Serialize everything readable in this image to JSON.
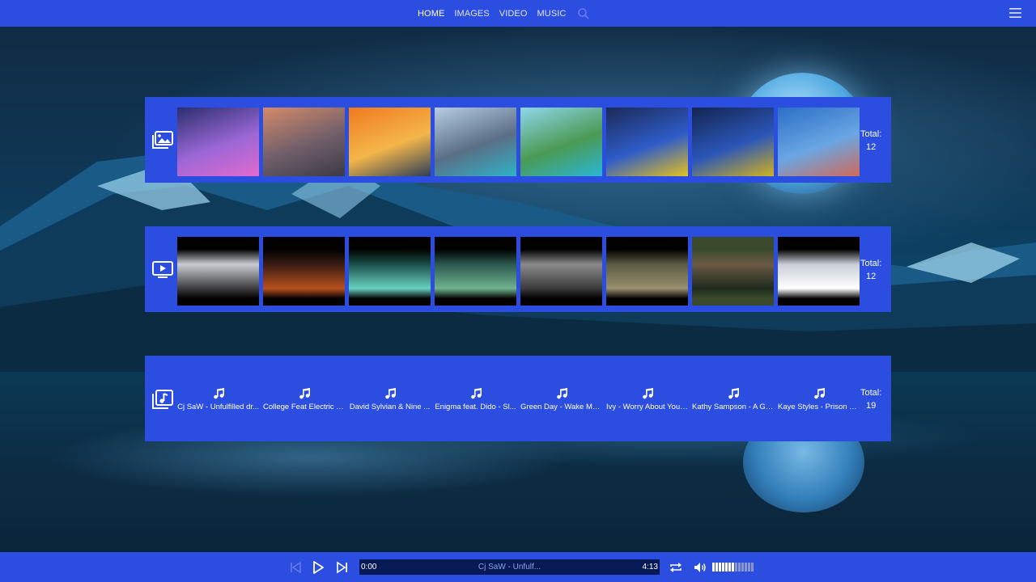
{
  "nav": {
    "items": [
      "HOME",
      "IMAGES",
      "VIDEO",
      "MUSIC"
    ],
    "active": "HOME",
    "icons": [
      "search-icon",
      "menu-icon"
    ]
  },
  "images_panel": {
    "icon": "images-icon",
    "total_label": "Total:",
    "total_value": "12",
    "thumbnails": [
      {
        "name": "cyberpunk-girl",
        "colors": [
          "#2a2f6e",
          "#9b67d6",
          "#e26ad0"
        ]
      },
      {
        "name": "misty-mountains",
        "colors": [
          "#d48a6a",
          "#6f5e6a",
          "#3b3a44"
        ]
      },
      {
        "name": "sunset-peak",
        "colors": [
          "#f07a1e",
          "#f4b64a",
          "#2d3e57"
        ]
      },
      {
        "name": "glacier-lake",
        "colors": [
          "#b7cde4",
          "#5a6f86",
          "#2fb2c8"
        ]
      },
      {
        "name": "turquoise-lake",
        "colors": [
          "#8fd6ec",
          "#4b9a54",
          "#2ab6d6"
        ]
      },
      {
        "name": "eagle-ukraine",
        "colors": [
          "#1b2a57",
          "#2e5cc8",
          "#e6c11f"
        ]
      },
      {
        "name": "ukraine-flag-art",
        "colors": [
          "#132550",
          "#2b56b8",
          "#d2b21f"
        ]
      },
      {
        "name": "blue-horizon",
        "colors": [
          "#2b6fc7",
          "#6aa6e3",
          "#d06a5a"
        ]
      }
    ]
  },
  "video_panel": {
    "icon": "video-icon",
    "total_label": "Total:",
    "total_value": "12",
    "thumbnails": [
      {
        "name": "video-1",
        "colors": [
          "#000000",
          "#c9cdd2",
          "#3d3d40"
        ]
      },
      {
        "name": "video-2",
        "colors": [
          "#000000",
          "#3a1c12",
          "#b6501e"
        ]
      },
      {
        "name": "video-3",
        "colors": [
          "#000000",
          "#1b4f4a",
          "#6ad0c0"
        ]
      },
      {
        "name": "video-4",
        "colors": [
          "#000000",
          "#2b5850",
          "#70b38f"
        ]
      },
      {
        "name": "video-5",
        "colors": [
          "#000000",
          "#8a8a8a",
          "#3b3b3b"
        ]
      },
      {
        "name": "video-6",
        "colors": [
          "#000000",
          "#5b5a42",
          "#9a8f70"
        ]
      },
      {
        "name": "video-7",
        "colors": [
          "#3b4a2c",
          "#6a5a45",
          "#1f2a1f"
        ]
      },
      {
        "name": "video-8",
        "colors": [
          "#000000",
          "#c9ced6",
          "#ffffff"
        ]
      }
    ]
  },
  "music_panel": {
    "icon": "music-library-icon",
    "total_label": "Total:",
    "total_value": "19",
    "tracks": [
      "Cj SaW - Unfulfilled dr...",
      "College Feat Electric Y...",
      "David Sylvian & Nine ...",
      "Enigma feat. Dido - Sl...",
      "Green Day - Wake Me ...",
      "Ivy - Worry About You....",
      "Kathy Sampson - A Go...",
      "Kaye Styles - Prison Br..."
    ]
  },
  "player": {
    "current_time": "0:00",
    "track_title": "Cj SaW - Unfulf...",
    "duration": "4:13",
    "volume_level": 0.5,
    "icons": [
      "previous-icon",
      "play-icon",
      "next-icon",
      "repeat-icon",
      "volume-icon"
    ]
  }
}
